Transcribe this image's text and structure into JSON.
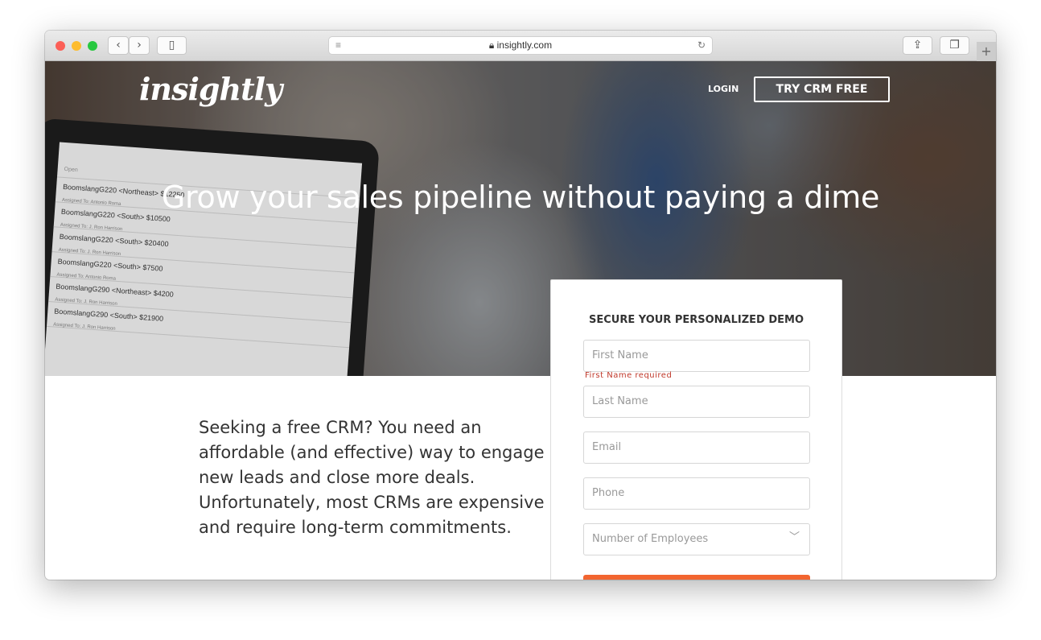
{
  "browser": {
    "url": "insightly.com"
  },
  "nav": {
    "logo": "insightly",
    "login": "LOGIN",
    "try": "TRY CRM FREE"
  },
  "hero": {
    "headline": "Grow your sales pipeline without paying a dime",
    "laptop_rows": [
      {
        "title": "BoomslangG220 <Northeast> $12250",
        "sub": "Assigned To: Antonio Roma"
      },
      {
        "title": "BoomslangG220 <South> $10500",
        "sub": "Assigned To: J. Ron Harrison"
      },
      {
        "title": "BoomslangG220 <South> $20400",
        "sub": "Assigned To: J. Ron Harrison"
      },
      {
        "title": "BoomslangG220 <South> $7500",
        "sub": "Assigned To: Antonio Roma"
      },
      {
        "title": "BoomslangG290 <Northeast> $4200",
        "sub": "Assigned To: J. Ron Harrison"
      },
      {
        "title": "BoomslangG290 <South> $21900",
        "sub": "Assigned To: J. Ron Harrison"
      }
    ]
  },
  "body": {
    "copy": "Seeking a free CRM? You need an affordable (and effective) way to engage new leads and close more deals. Unfortunately, most CRMs are expensive and require long-term commitments."
  },
  "form": {
    "title": "SECURE YOUR PERSONALIZED DEMO",
    "first": "First Name",
    "first_error": "First Name required",
    "last": "Last Name",
    "email": "Email",
    "phone": "Phone",
    "employees": "Number of Employees"
  },
  "colors": {
    "accent": "#f26530",
    "error": "#c0392b"
  }
}
